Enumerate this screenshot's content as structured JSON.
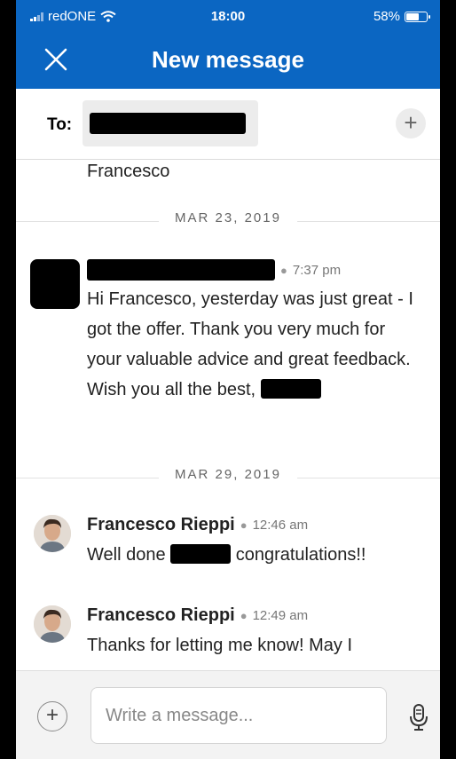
{
  "status_bar": {
    "carrier": "redONE",
    "time": "18:00",
    "battery": "58%",
    "battery_level": 0.58,
    "icons": [
      "signal-icon",
      "wifi-icon",
      "battery-icon"
    ]
  },
  "nav": {
    "title": "New message",
    "close_icon": "close-icon",
    "background": "#0b66c2"
  },
  "recipient": {
    "label": "To:",
    "add_icon": "plus-icon"
  },
  "thread": {
    "previous_text": "Francesco",
    "date_1": "MAR 23, 2019",
    "message_1": {
      "time": "7:37 pm",
      "body": "Hi Francesco, yesterday was just great - I got the offer. Thank you very much for your valuable advice and great feedback. Wish you all the best,"
    },
    "date_2": "MAR 29, 2019",
    "message_2": {
      "sender": "Francesco Rieppi",
      "time": "12:46 am",
      "body_before": "Well done",
      "body_after": "congratulations!!"
    },
    "message_3": {
      "sender": "Francesco Rieppi",
      "time": "12:49 am",
      "body": "Thanks for letting me know! May I"
    }
  },
  "composer": {
    "placeholder": "Write a message...",
    "attach_icon": "plus-icon",
    "mic_icon": "microphone-icon"
  }
}
